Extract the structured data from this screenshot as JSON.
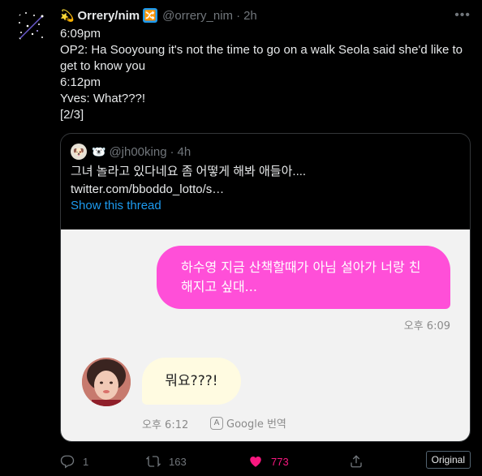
{
  "tweet": {
    "emoji": "💫",
    "name": "Orrery/nim",
    "badge_icon": "🔀",
    "handle": "@orrery_nim",
    "separator": "·",
    "time": "2h",
    "more_icon": "•••",
    "lines": [
      "6:09pm",
      "OP2: Ha Sooyoung it's not the time to go on a walk Seola said she'd like to get to know you",
      "6:12pm",
      "Yves: What???!",
      "[2/3]"
    ]
  },
  "quote": {
    "avatar_icon": "🐶",
    "emoji": "🐻‍❄️",
    "handle": "@jh00king",
    "separator": "·",
    "time": "4h",
    "text": "그녀 놀라고 있다네요 좀 어떻게 해봐 애들아....",
    "link": "twitter.com/bboddo_lotto/s…",
    "show_thread": "Show this thread"
  },
  "chat": {
    "outgoing_text": "하수영 지금 산책할때가 아님 설아가 너랑 친해지고 싶대...",
    "outgoing_time": "오후 6:09",
    "incoming_text": "뭐요???!",
    "incoming_time": "오후 6:12",
    "translate_icon": "A",
    "translate_label": "Google 번역"
  },
  "actions": {
    "reply_count": "1",
    "retweet_count": "163",
    "like_count": "773",
    "original_label": "Original"
  },
  "colors": {
    "background": "#000000",
    "accent": "#1d9bf0",
    "like": "#f91880",
    "bubble_out": "#ff4fd8",
    "bubble_in": "#fffbe1"
  }
}
